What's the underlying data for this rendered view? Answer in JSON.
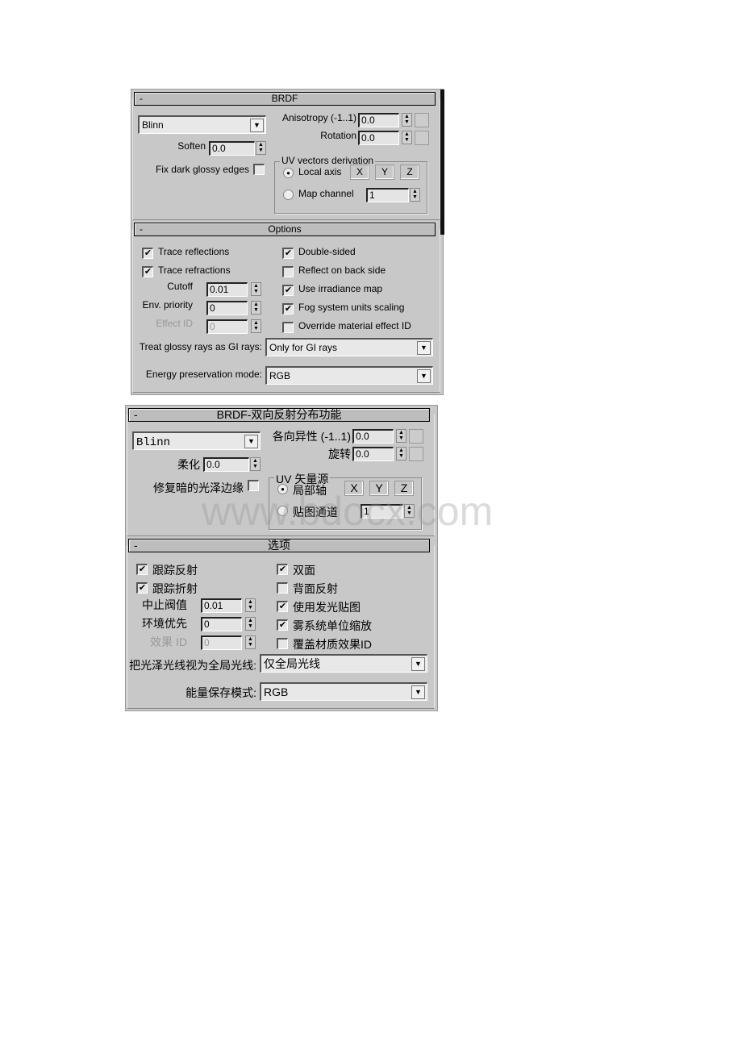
{
  "panels": [
    {
      "brdf": {
        "collapse": "-",
        "title": "BRDF",
        "shader": "Blinn",
        "anisotropy_label": "Anisotropy (-1..1)",
        "anisotropy": "0.0",
        "rotation_label": "Rotation",
        "rotation": "0.0",
        "soften_label": "Soften",
        "soften": "0.0",
        "fix_label": "Fix dark glossy edges",
        "fix_checked": false,
        "uv_group": "UV vectors derivation",
        "local_axis": "Local axis",
        "local_selected": true,
        "x": "X",
        "y": "Y",
        "z": "Z",
        "map_channel": "Map channel",
        "map_channel_value": "1"
      },
      "options": {
        "collapse": "-",
        "title": "Options",
        "left_checks": [
          {
            "label": "Trace reflections",
            "checked": true
          },
          {
            "label": "Trace refractions",
            "checked": true
          }
        ],
        "cutoff_label": "Cutoff",
        "cutoff": "0.01",
        "env_label": "Env. priority",
        "env": "0",
        "effect_label": "Effect ID",
        "effect": "0",
        "right_checks": [
          {
            "label": "Double-sided",
            "checked": true
          },
          {
            "label": "Reflect on back side",
            "checked": false
          },
          {
            "label": "Use irradiance map",
            "checked": true
          },
          {
            "label": "Fog system units scaling",
            "checked": true
          },
          {
            "label": "Override material effect ID",
            "checked": false
          }
        ],
        "glossy_label": "Treat glossy rays as GI rays:",
        "glossy_value": "Only for GI rays",
        "energy_label": "Energy preservation mode:",
        "energy_value": "RGB"
      }
    },
    {
      "brdf": {
        "collapse": "-",
        "title": "BRDF-双向反射分布功能",
        "shader": "Blinn",
        "anisotropy_label": "各向异性 (-1..1)",
        "anisotropy": "0.0",
        "rotation_label": "旋转",
        "rotation": "0.0",
        "soften_label": "柔化",
        "soften": "0.0",
        "fix_label": "修复暗的光泽边缘",
        "fix_checked": false,
        "uv_group": "UV 矢量源",
        "local_axis": "局部轴",
        "local_selected": true,
        "x": "X",
        "y": "Y",
        "z": "Z",
        "map_channel": "贴图通道",
        "map_channel_value": "1"
      },
      "options": {
        "collapse": "-",
        "title": "选项",
        "left_checks": [
          {
            "label": "跟踪反射",
            "checked": true
          },
          {
            "label": "跟踪折射",
            "checked": true
          }
        ],
        "cutoff_label": "中止阀值",
        "cutoff": "0.01",
        "env_label": "环境优先",
        "env": "0",
        "effect_label": "效果 ID",
        "effect": "0",
        "right_checks": [
          {
            "label": "双面",
            "checked": true
          },
          {
            "label": "背面反射",
            "checked": false
          },
          {
            "label": "使用发光贴图",
            "checked": true
          },
          {
            "label": "雾系统单位缩放",
            "checked": true
          },
          {
            "label": "覆盖材质效果ID",
            "checked": false
          }
        ],
        "glossy_label": "把光泽光线视为全局光线:",
        "glossy_value": "仅全局光线",
        "energy_label": "能量保存模式:",
        "energy_value": "RGB"
      }
    }
  ],
  "watermark": "www.bdocx.com"
}
